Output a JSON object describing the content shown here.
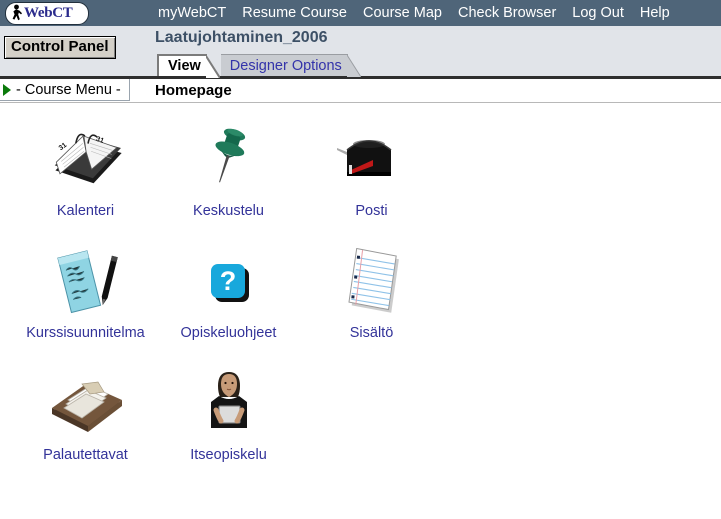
{
  "brand": {
    "logo_text": "WebCT",
    "logo_figure_name": "walking-person-figure",
    "nav_bar_color": "#4f6579",
    "label_link_color": "#333399",
    "title_color": "#3d5066"
  },
  "topnav": {
    "items": [
      {
        "label": "myWebCT",
        "name": "nav-mywebct"
      },
      {
        "label": "Resume Course",
        "name": "nav-resume-course"
      },
      {
        "label": "Course Map",
        "name": "nav-course-map"
      },
      {
        "label": "Check Browser",
        "name": "nav-check-browser"
      },
      {
        "label": "Log Out",
        "name": "nav-log-out"
      },
      {
        "label": "Help",
        "name": "nav-help"
      }
    ]
  },
  "header": {
    "control_panel_label": "Control Panel",
    "course_title": "Laatujohtaminen_2006",
    "tabs": [
      {
        "label": "View",
        "active": true
      },
      {
        "label": "Designer Options",
        "active": false
      }
    ]
  },
  "menurow": {
    "course_menu_label": "- Course Menu -",
    "breadcrumb": "Homepage"
  },
  "content": {
    "rows": [
      [
        {
          "label": "Kalenteri",
          "icon": "desk-calendar-icon"
        },
        {
          "label": "Keskustelu",
          "icon": "green-pushpin-icon"
        },
        {
          "label": "Posti",
          "icon": "mailbox-icon"
        }
      ],
      [
        {
          "label": "Kurssisuunnitelma",
          "icon": "notepad-pen-icon"
        },
        {
          "label": "Opiskeluohjeet",
          "icon": "question-mark-icon"
        },
        {
          "label": "Sisältö",
          "icon": "lined-paper-icon"
        }
      ],
      [
        {
          "label": "Palautettavat",
          "icon": "inbox-tray-icon"
        },
        {
          "label": "Itseopiskelu",
          "icon": "person-with-book-icon"
        }
      ]
    ]
  }
}
